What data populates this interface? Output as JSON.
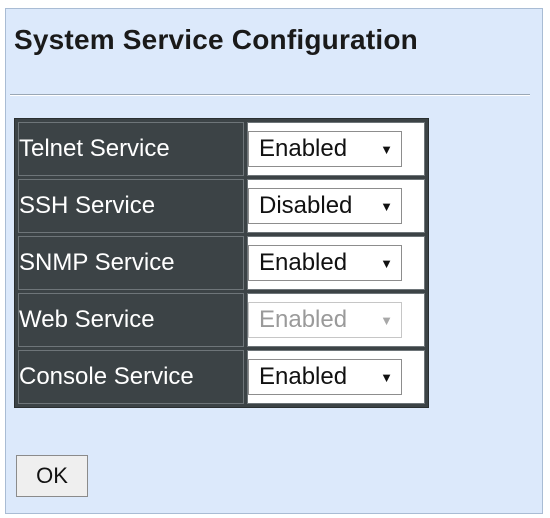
{
  "page": {
    "title": "System Service Configuration"
  },
  "services": [
    {
      "label": "Telnet Service",
      "value": "Enabled",
      "disabled": false
    },
    {
      "label": "SSH Service",
      "value": "Disabled",
      "disabled": false
    },
    {
      "label": "SNMP Service",
      "value": "Enabled",
      "disabled": false
    },
    {
      "label": "Web Service",
      "value": "Enabled",
      "disabled": true
    },
    {
      "label": "Console Service",
      "value": "Enabled",
      "disabled": false
    }
  ],
  "actions": {
    "ok_label": "OK"
  },
  "icons": {
    "dropdown": "dropdown-arrow-icon"
  },
  "colors": {
    "background": "#dce9fb",
    "label_cell": "#3c4346",
    "label_text": "#ffffff"
  }
}
